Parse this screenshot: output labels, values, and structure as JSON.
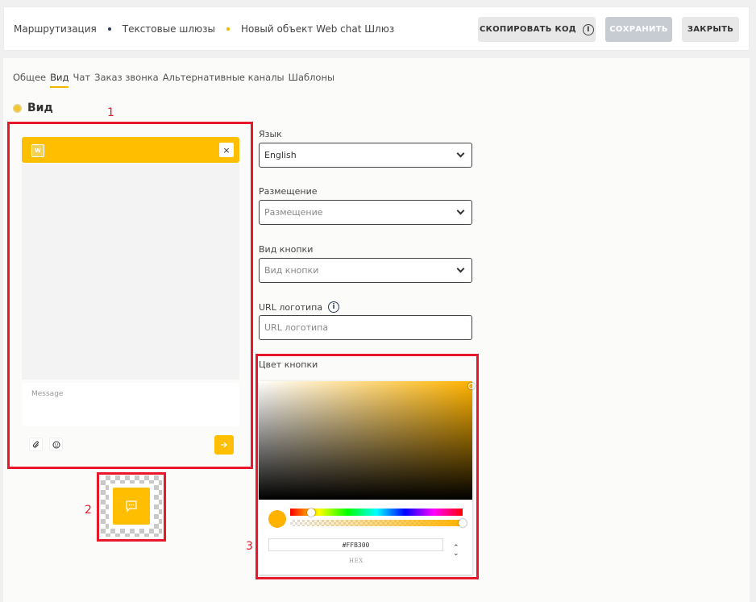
{
  "breadcrumbs": {
    "items": [
      "Маршрутизация",
      "Текстовые шлюзы",
      "Новый объект Web chat Шлюз"
    ],
    "dot_colors": [
      "#2b3a55",
      "#f2b500"
    ]
  },
  "actions": {
    "copy_code": "СКОПИРОВАТЬ КОД",
    "save": "СОХРАНИТЬ",
    "close": "ЗАКРЫТЬ"
  },
  "tabs": [
    "Общее",
    "Вид",
    "Чат",
    "Заказ звонка",
    "Альтернативные каналы",
    "Шаблоны"
  ],
  "active_tab": "Вид",
  "section_title": "Вид",
  "annotations": [
    "1",
    "2",
    "3"
  ],
  "widget_preview": {
    "logo_letter": "W",
    "close_symbol": "×",
    "message_placeholder": "Message",
    "accent_color": "#ffbf00"
  },
  "form": {
    "language_label": "Язык",
    "language_value": "English",
    "placement_label": "Размещение",
    "placement_placeholder": "Размещение",
    "button_type_label": "Вид кнопки",
    "button_type_placeholder": "Вид кнопки",
    "logo_url_label": "URL логотипа",
    "logo_url_placeholder": "URL логотипа",
    "button_color_label": "Цвет кнопки"
  },
  "color_picker": {
    "hex_value": "#FFB300",
    "mode_label": "HEX",
    "hue_level": 0.12,
    "alpha_level": 1.0
  },
  "colors": {
    "annotation_red": "#e8172c",
    "brand_yellow": "#ffbf00"
  }
}
